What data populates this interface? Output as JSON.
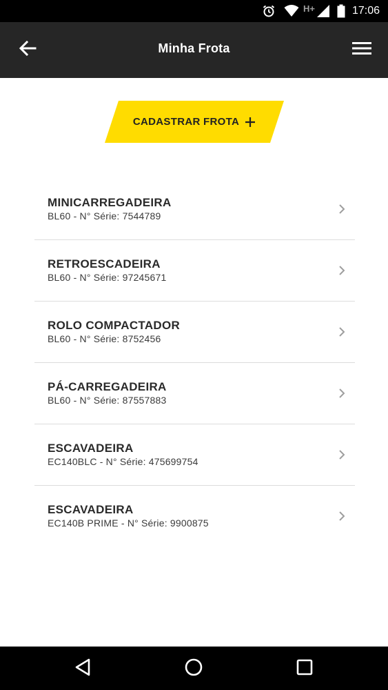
{
  "status_bar": {
    "time": "17:06",
    "network_label": "H+",
    "icons": [
      "alarm-icon",
      "wifi-icon",
      "signal-icon",
      "battery-icon"
    ]
  },
  "app_bar": {
    "title": "Minha Frota",
    "back_icon": "arrow-left-icon",
    "menu_icon": "hamburger-menu-icon",
    "background": "#262626"
  },
  "cta": {
    "label": "CADASTRAR FROTA",
    "icon": "plus-icon",
    "color": "#FFDC00"
  },
  "fleet": [
    {
      "title": "MINICARREGADEIRA",
      "subtitle": "BL60 - N° Série: 7544789"
    },
    {
      "title": "RETROESCADEIRA",
      "subtitle": "BL60 - N° Série: 97245671"
    },
    {
      "title": "ROLO COMPACTADOR",
      "subtitle": "BL60 - N° Série: 8752456"
    },
    {
      "title": "PÁ-CARREGADEIRA",
      "subtitle": "BL60 - N° Série: 87557883"
    },
    {
      "title": "ESCAVADEIRA",
      "subtitle": "EC140BLC - N° Série: 475699754"
    },
    {
      "title": "ESCAVADEIRA",
      "subtitle": "EC140B PRIME - N° Série: 9900875"
    }
  ],
  "nav_bar": {
    "icons": [
      "back-triangle-icon",
      "home-circle-icon",
      "recents-square-icon"
    ]
  }
}
